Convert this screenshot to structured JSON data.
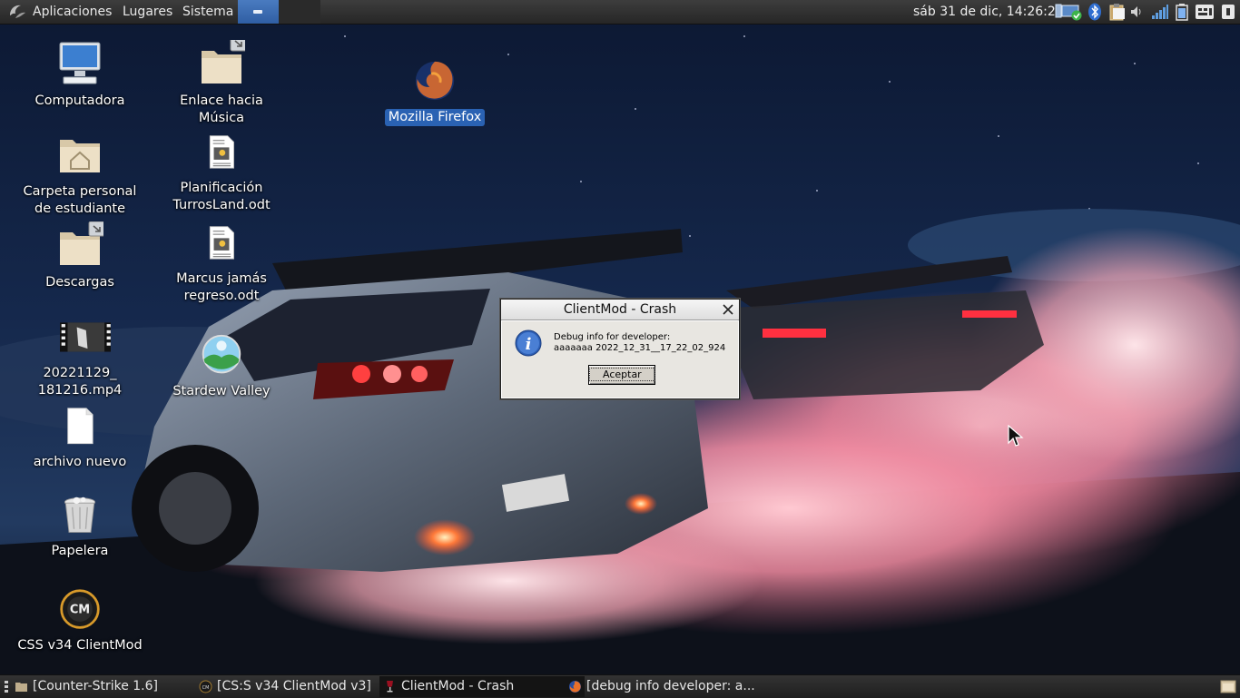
{
  "top_panel": {
    "menus": [
      "Aplicaciones",
      "Lugares",
      "Sistema"
    ],
    "clock": "sáb 31 de dic, 14:26:23",
    "tray_icons": [
      "network-icon",
      "bluetooth-icon",
      "clipboard-icon",
      "volume-icon",
      "signal-icon",
      "battery-icon",
      "keyboard-icon",
      "power-icon"
    ]
  },
  "desktop": {
    "icons": [
      {
        "label": "Computadora",
        "icon": "computer-icon"
      },
      {
        "label": "Carpeta personal\nde estudiante",
        "icon": "home-folder-icon"
      },
      {
        "label": "Descargas",
        "icon": "folder-link-icon"
      },
      {
        "label": "20221129_\n181216.mp4",
        "icon": "video-file-icon"
      },
      {
        "label": "archivo nuevo",
        "icon": "blank-file-icon"
      },
      {
        "label": "Papelera",
        "icon": "trash-icon"
      },
      {
        "label": "CSS v34 ClientMod",
        "icon": "clientmod-logo-icon"
      },
      {
        "label": "Enlace hacia\nMúsica",
        "icon": "folder-link-icon"
      },
      {
        "label": "Planificación\nTurrosLand.odt",
        "icon": "document-icon"
      },
      {
        "label": "Marcus jamás\nregreso.odt",
        "icon": "document-icon"
      },
      {
        "label": "Stardew Valley",
        "icon": "stardew-valley-icon"
      },
      {
        "label": "Mozilla Firefox",
        "icon": "firefox-icon"
      }
    ]
  },
  "dialog": {
    "title": "ClientMod - Crash",
    "line1": "Debug info for developer:",
    "line2": "aaaaaaa 2022_12_31__17_22_02_924",
    "ok_label": "Aceptar"
  },
  "taskbar": {
    "tasks": [
      {
        "label": "[Counter-Strike 1.6]",
        "icon": "folder-icon"
      },
      {
        "label": "[CS:S v34 ClientMod v3]",
        "icon": "clientmod-small-icon"
      },
      {
        "label": "ClientMod - Crash",
        "icon": "wine-icon"
      },
      {
        "label": "[debug info developer: a...",
        "icon": "firefox-small-icon"
      }
    ]
  },
  "colors": {
    "panel": "#2e2e2e",
    "selection": "#2a62b3",
    "dialog_bg": "#d4d0c8",
    "smoke": "#f08aa0"
  }
}
